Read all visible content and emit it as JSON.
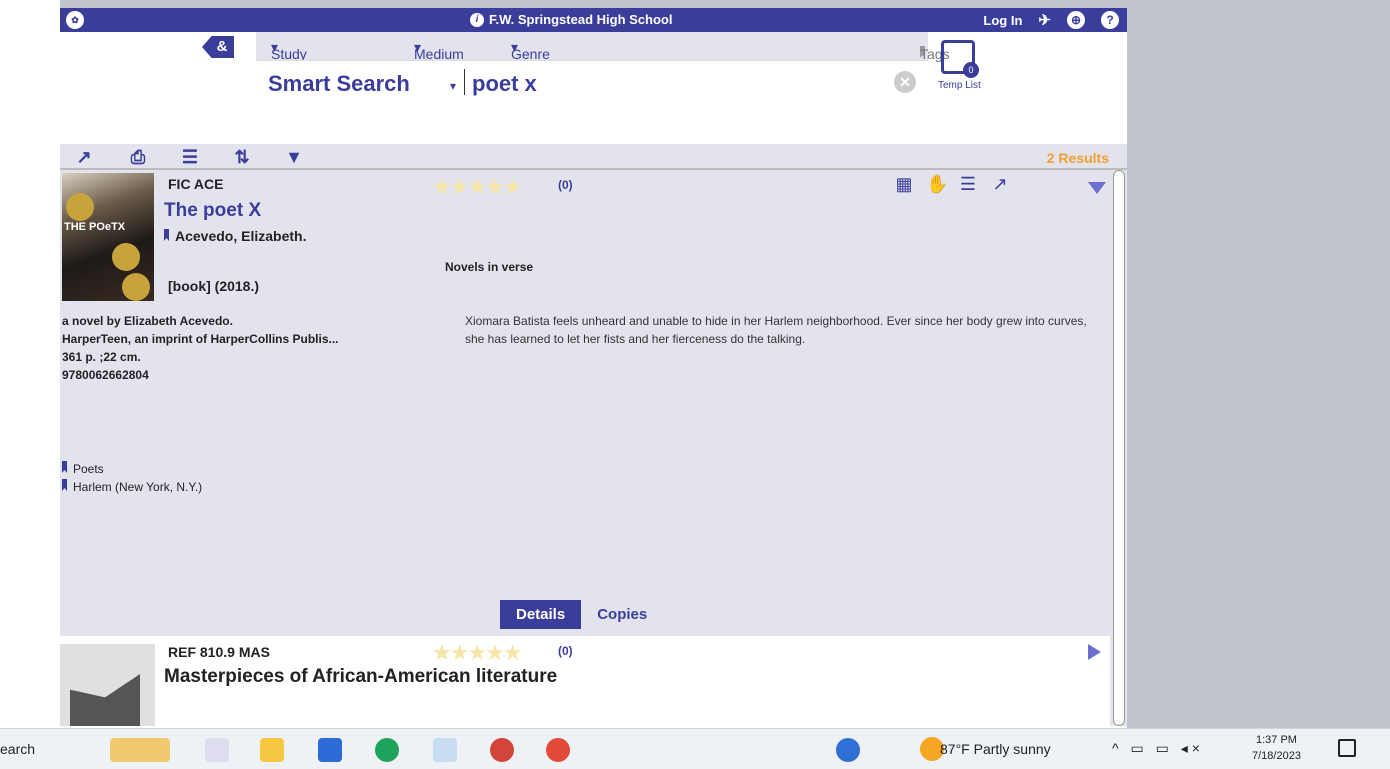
{
  "header": {
    "school": "F.W. Springstead High School",
    "login": "Log In"
  },
  "search": {
    "amp_label": "&",
    "filters": [
      "Study Programs",
      "Medium",
      "Genre"
    ],
    "tags_label": "Tags",
    "mode": "Smart Search",
    "query": "poet x",
    "temp_list_label": "Temp List",
    "temp_list_count": "0"
  },
  "toolbar": {
    "results": "2 Results"
  },
  "records": [
    {
      "call_number": "FIC ACE",
      "title": "The poet X",
      "author": "Acevedo, Elizabeth.",
      "format": "[book] (2018.)",
      "rating_count": "(0)",
      "rating_stars": "★★★★★",
      "subject_heading": "Novels in verse",
      "cover_text": "THE POeTX",
      "meta": [
        "a novel by Elizabeth Acevedo.",
        "HarperTeen, an imprint of HarperCollins Publis...",
        "361 p. ;22 cm.",
        "9780062662804"
      ],
      "summary": "Xiomara Batista feels unheard and unable to hide in her Harlem neighborhood. Ever since her body grew into curves, she has learned to let her fists and her fierceness do the talking.",
      "subjects": [
        "Poets",
        "Harlem (New York, N.Y.)"
      ],
      "tabs": [
        "Details",
        "Copies"
      ]
    },
    {
      "call_number": "REF 810.9 MAS",
      "title": "Masterpieces of African-American literature",
      "rating_count": "(0)",
      "rating_stars": "★★★★★"
    }
  ],
  "taskbar": {
    "search": "earch",
    "weather": "87°F  Partly sunny",
    "time": "1:37 PM",
    "date": "7/18/2023"
  }
}
